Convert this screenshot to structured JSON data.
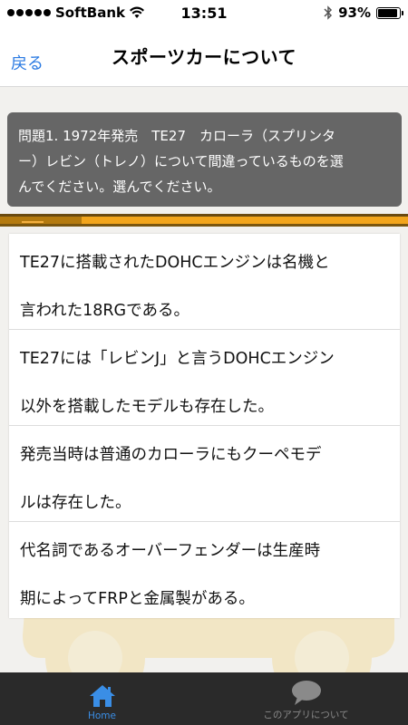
{
  "status_bar": {
    "carrier": "SoftBank",
    "time": "13:51",
    "battery_text": "93%",
    "battery_level": 0.93
  },
  "nav": {
    "back_label": "戻る",
    "title": "スポーツカーについて"
  },
  "question": {
    "line1": "問題1. 1972年発売　TE27　カローラ（スプリンタ",
    "line2": "ー）レビン（トレノ）について間違っているものを選",
    "line3": "んでください。選んでください。"
  },
  "progress": {
    "fraction": 0.2
  },
  "answers": [
    {
      "line1": "TE27に搭載されたDOHCエンジンは名機と",
      "line2": "言われた18RGである。"
    },
    {
      "line1": "TE27には「レビンJ」と言うDOHCエンジン",
      "line2": "以外を搭載したモデルも存在した。"
    },
    {
      "line1": "発売当時は普通のカローラにもクーペモデ",
      "line2": "ルは存在した。"
    },
    {
      "line1": "代名詞であるオーバーフェンダーは生産時",
      "line2": "期によってFRPと金属製がある。"
    }
  ],
  "tabs": [
    {
      "label": "Home",
      "icon": "house-icon",
      "active": true
    },
    {
      "label": "このアプリについて",
      "icon": "speech-bubble-icon",
      "active": false
    }
  ],
  "colors": {
    "accent": "#2a7ae2",
    "question_bg": "#666666",
    "progress_fill": "#f2a51c",
    "progress_track": "#b47a0f",
    "tab_bar_bg": "#2a2a2a",
    "tab_active": "#3a8ee6"
  }
}
